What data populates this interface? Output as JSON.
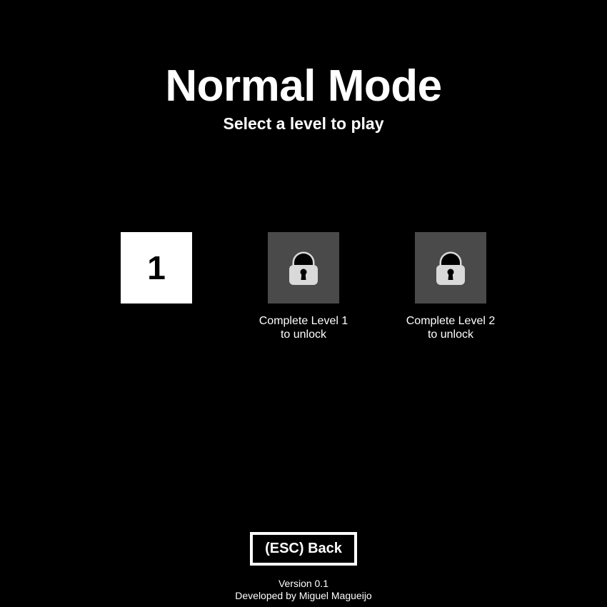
{
  "header": {
    "title": "Normal Mode",
    "subtitle": "Select a level to play"
  },
  "levels": [
    {
      "label": "1",
      "locked": false
    },
    {
      "locked": true,
      "icon": "lock-icon",
      "caption_line1": "Complete Level 1",
      "caption_line2": "to unlock"
    },
    {
      "locked": true,
      "icon": "lock-icon",
      "caption_line1": "Complete Level 2",
      "caption_line2": "to unlock"
    }
  ],
  "back_button": {
    "label": "(ESC) Back"
  },
  "footer": {
    "version": "Version 0.1",
    "developer": "Developed by Miguel Magueijo"
  },
  "colors": {
    "background": "#000000",
    "unlocked_tile": "#ffffff",
    "locked_tile": "#4a4a4a",
    "lock_body": "#d9d9d9"
  }
}
